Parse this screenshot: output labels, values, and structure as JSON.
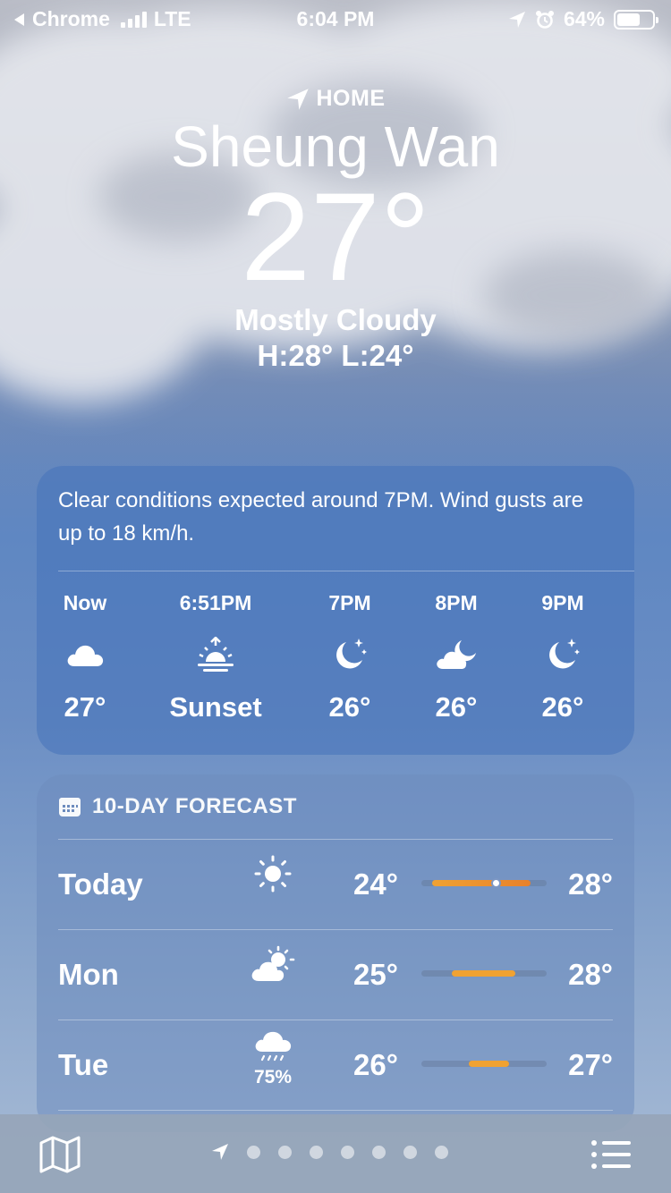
{
  "status_bar": {
    "back_app": "Chrome",
    "network": "LTE",
    "time": "6:04 PM",
    "battery": "64%"
  },
  "header": {
    "location_label": "HOME",
    "city": "Sheung Wan",
    "temperature": "27°",
    "condition": "Mostly Cloudy",
    "hi_lo": "H:28°  L:24°"
  },
  "hourly_card": {
    "summary": "Clear conditions expected around 7PM. Wind gusts are up to 18 km/h.",
    "hours": [
      {
        "time": "Now",
        "icon": "cloud-icon",
        "value": "27°"
      },
      {
        "time": "6:51PM",
        "icon": "sunset-icon",
        "value": "Sunset"
      },
      {
        "time": "7PM",
        "icon": "moon-stars-icon",
        "value": "26°"
      },
      {
        "time": "8PM",
        "icon": "cloud-moon-icon",
        "value": "26°"
      },
      {
        "time": "9PM",
        "icon": "moon-stars-icon",
        "value": "26°"
      }
    ]
  },
  "forecast_card": {
    "title": "10-DAY FORECAST",
    "days": [
      {
        "day": "Today",
        "icon": "sun-icon",
        "low": "24°",
        "high": "28°",
        "precip": ""
      },
      {
        "day": "Mon",
        "icon": "cloud-sun-icon",
        "low": "25°",
        "high": "28°",
        "precip": ""
      },
      {
        "day": "Tue",
        "icon": "cloud-rain-icon",
        "low": "26°",
        "high": "27°",
        "precip": "75%"
      }
    ]
  },
  "bottom_bar": {
    "page_count": 7
  },
  "colors": {
    "temp_bar": "#f0a232",
    "today_bar_accent": "#e8812b"
  }
}
